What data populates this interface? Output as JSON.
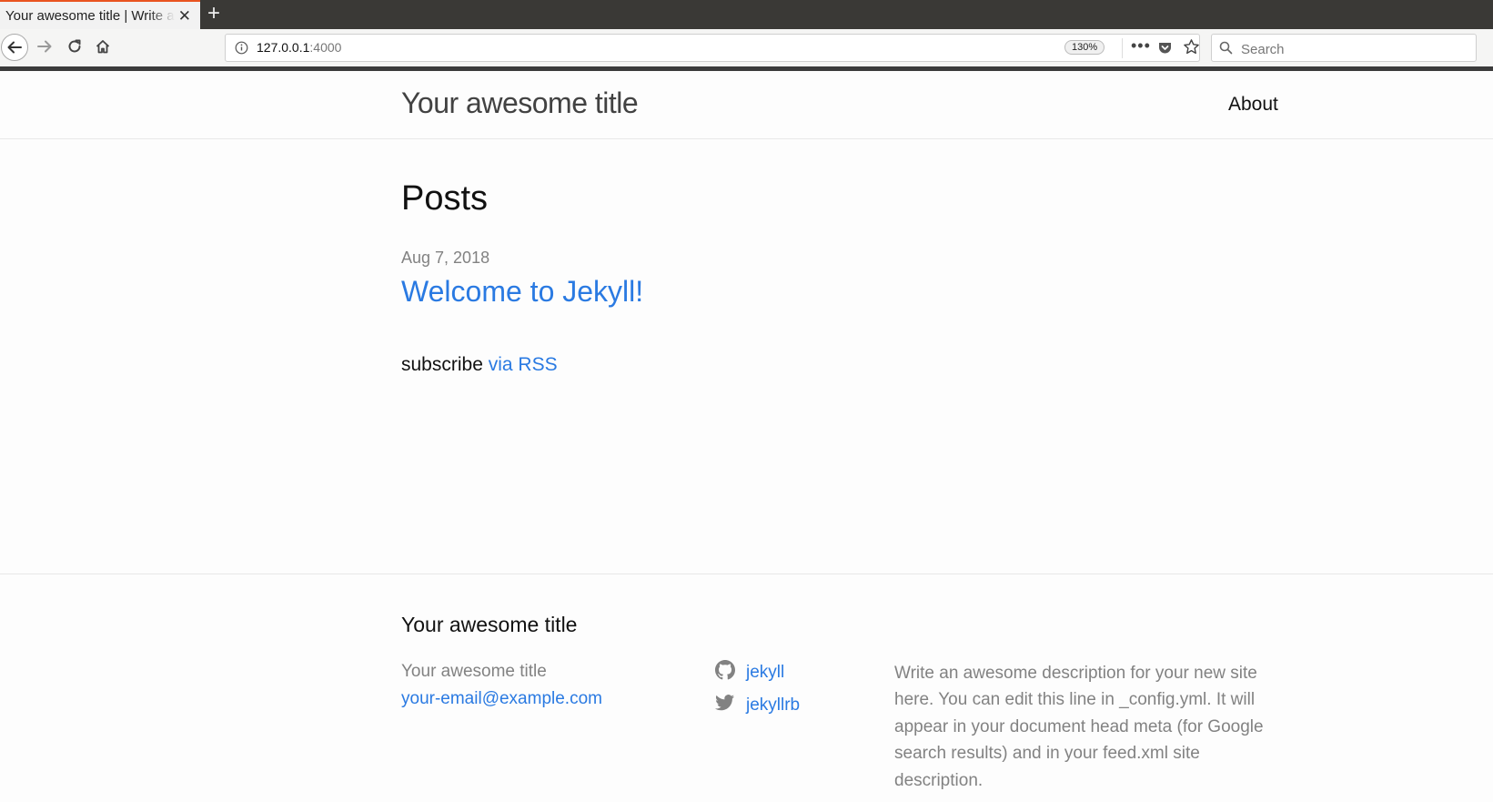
{
  "browser": {
    "tab_title": "Your awesome title | Write an awesome description for your new site",
    "new_tab_symbol": "+",
    "close_symbol": "✕",
    "url_host": "127.0.0.1",
    "url_port": ":4000",
    "zoom_level": "130%",
    "more_symbol": "•••",
    "search_placeholder": "Search"
  },
  "header": {
    "site_title": "Your awesome title",
    "nav_about": "About"
  },
  "main": {
    "heading": "Posts",
    "posts": [
      {
        "date": "Aug 7, 2018",
        "title": "Welcome to Jekyll!"
      }
    ],
    "subscribe_text": "subscribe",
    "rss_link": "via RSS"
  },
  "footer": {
    "heading": "Your awesome title",
    "name": "Your awesome title",
    "email": "your-email@example.com",
    "github_user": "jekyll",
    "twitter_user": "jekyllrb",
    "description": "Write an awesome description for your new site here. You can edit this line in _config.yml. It will appear in your document head meta (for Google search results) and in your feed.xml site description."
  },
  "colors": {
    "link": "#2a7ae2",
    "muted": "#828282",
    "tab_accent": "#e95420",
    "tabbar_bg": "#3a3936"
  }
}
